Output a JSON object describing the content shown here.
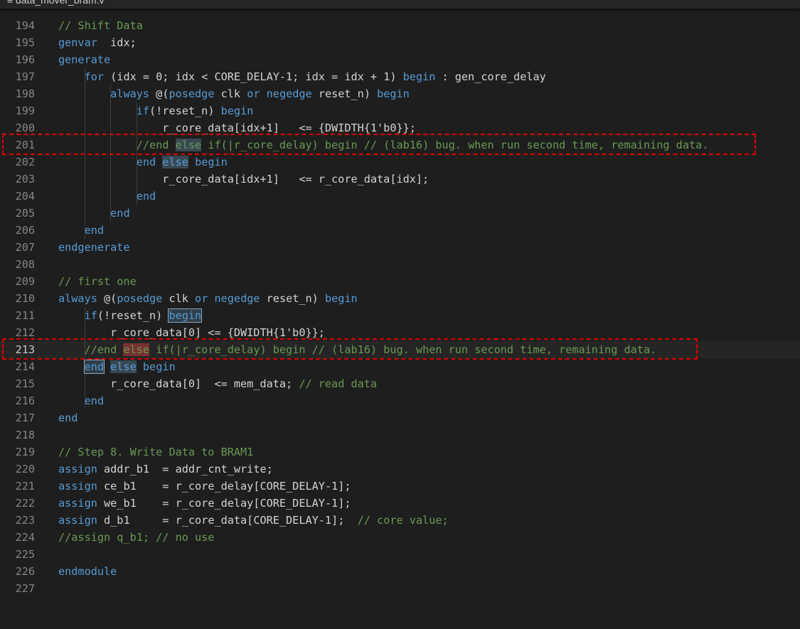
{
  "tab": {
    "filename": "≡ data_mover_bram.v"
  },
  "editor": {
    "lines": [
      {
        "n": "194",
        "tokens": [
          [
            "// Shift Data",
            "cm"
          ]
        ]
      },
      {
        "n": "195",
        "tokens": [
          [
            "genvar",
            "kw"
          ],
          [
            "  idx;",
            ""
          ]
        ]
      },
      {
        "n": "196",
        "tokens": [
          [
            "generate",
            "kw"
          ]
        ]
      },
      {
        "n": "197",
        "tokens": [
          [
            "    ",
            ""
          ],
          [
            "for",
            "kw"
          ],
          [
            " (idx = 0; idx < CORE_DELAY-1; idx = idx + 1) ",
            ""
          ],
          [
            "begin",
            "kw"
          ],
          [
            " : gen_core_delay",
            ""
          ]
        ]
      },
      {
        "n": "198",
        "tokens": [
          [
            "        ",
            ""
          ],
          [
            "always",
            "kw"
          ],
          [
            " @(",
            ""
          ],
          [
            "posedge",
            "kw"
          ],
          [
            " clk ",
            ""
          ],
          [
            "or",
            "kw"
          ],
          [
            " ",
            ""
          ],
          [
            "negedge",
            "kw"
          ],
          [
            " reset_n) ",
            ""
          ],
          [
            "begin",
            "kw"
          ]
        ]
      },
      {
        "n": "199",
        "tokens": [
          [
            "            ",
            ""
          ],
          [
            "if",
            "kw"
          ],
          [
            "(!reset_n) ",
            ""
          ],
          [
            "begin",
            "kw"
          ]
        ]
      },
      {
        "n": "200",
        "tokens": [
          [
            "                r_core_data[idx+1]   <= {DWIDTH{1'b0}};",
            ""
          ]
        ]
      },
      {
        "n": "201",
        "tokens": [
          [
            "            ",
            ""
          ],
          [
            "//end ",
            "cm"
          ],
          [
            "else",
            "cm hl"
          ],
          [
            " if(|r_core_delay) begin // (lab16) bug. when run second time, remaining data.",
            "cm"
          ]
        ]
      },
      {
        "n": "202",
        "tokens": [
          [
            "            ",
            ""
          ],
          [
            "end",
            "kw"
          ],
          [
            " ",
            ""
          ],
          [
            "else",
            "kw hl"
          ],
          [
            " ",
            ""
          ],
          [
            "begin",
            "kw"
          ]
        ]
      },
      {
        "n": "203",
        "tokens": [
          [
            "                r_core_data[idx+1]   <= r_core_data[idx];",
            ""
          ]
        ]
      },
      {
        "n": "204",
        "tokens": [
          [
            "            ",
            ""
          ],
          [
            "end",
            "kw"
          ]
        ]
      },
      {
        "n": "205",
        "tokens": [
          [
            "        ",
            ""
          ],
          [
            "end",
            "kw"
          ]
        ]
      },
      {
        "n": "206",
        "tokens": [
          [
            "    ",
            ""
          ],
          [
            "end",
            "kw"
          ]
        ]
      },
      {
        "n": "207",
        "tokens": [
          [
            "endgenerate",
            "kw"
          ]
        ]
      },
      {
        "n": "208",
        "tokens": []
      },
      {
        "n": "209",
        "tokens": [
          [
            "// first one",
            "cm"
          ]
        ]
      },
      {
        "n": "210",
        "tokens": [
          [
            "always",
            "kw"
          ],
          [
            " @(",
            ""
          ],
          [
            "posedge",
            "kw"
          ],
          [
            " clk ",
            ""
          ],
          [
            "or",
            "kw"
          ],
          [
            " ",
            ""
          ],
          [
            "negedge",
            "kw"
          ],
          [
            " reset_n) ",
            ""
          ],
          [
            "begin",
            "kw"
          ]
        ]
      },
      {
        "n": "211",
        "tokens": [
          [
            "    ",
            ""
          ],
          [
            "if",
            "kw"
          ],
          [
            "(!reset_n) ",
            ""
          ],
          [
            "begin",
            "kw hlbox"
          ]
        ]
      },
      {
        "n": "212",
        "tokens": [
          [
            "        r_core_data[0] <= {DWIDTH{1'b0}};",
            ""
          ]
        ]
      },
      {
        "n": "213",
        "tokens": [
          [
            "    ",
            ""
          ],
          [
            "//end ",
            "cm"
          ],
          [
            "else",
            "cm hlred"
          ],
          [
            " if(|r_core_delay) begin // (lab16) bug. when run second time, remaining data.",
            "cm"
          ]
        ]
      },
      {
        "n": "214",
        "tokens": [
          [
            "    ",
            ""
          ],
          [
            "end",
            "kw hlbox"
          ],
          [
            " ",
            ""
          ],
          [
            "else",
            "kw hl"
          ],
          [
            " ",
            ""
          ],
          [
            "begin",
            "kw"
          ]
        ]
      },
      {
        "n": "215",
        "tokens": [
          [
            "        r_core_data[0]  <= mem_data; ",
            ""
          ],
          [
            "// read data",
            "cm"
          ]
        ]
      },
      {
        "n": "216",
        "tokens": [
          [
            "    ",
            ""
          ],
          [
            "end",
            "kw"
          ]
        ]
      },
      {
        "n": "217",
        "tokens": [
          [
            "end",
            "kw"
          ]
        ]
      },
      {
        "n": "218",
        "tokens": []
      },
      {
        "n": "219",
        "tokens": [
          [
            "// Step 8. Write Data to BRAM1",
            "cm"
          ]
        ]
      },
      {
        "n": "220",
        "tokens": [
          [
            "assign",
            "kw"
          ],
          [
            " addr_b1  = addr_cnt_write;",
            ""
          ]
        ]
      },
      {
        "n": "221",
        "tokens": [
          [
            "assign",
            "kw"
          ],
          [
            " ce_b1    = r_core_delay[CORE_DELAY-1];",
            ""
          ]
        ]
      },
      {
        "n": "222",
        "tokens": [
          [
            "assign",
            "kw"
          ],
          [
            " we_b1    = r_core_delay[CORE_DELAY-1];",
            ""
          ]
        ]
      },
      {
        "n": "223",
        "tokens": [
          [
            "assign",
            "kw"
          ],
          [
            " d_b1     = r_core_data[CORE_DELAY-1];  ",
            ""
          ],
          [
            "// core value;",
            "cm"
          ]
        ]
      },
      {
        "n": "224",
        "tokens": [
          [
            "//assign q_b1; // no use",
            "cm"
          ]
        ]
      },
      {
        "n": "225",
        "tokens": []
      },
      {
        "n": "226",
        "tokens": [
          [
            "endmodule",
            "kw"
          ]
        ]
      },
      {
        "n": "227",
        "tokens": []
      }
    ],
    "active_line": "213",
    "annotated_lines": [
      "201",
      "213"
    ]
  }
}
